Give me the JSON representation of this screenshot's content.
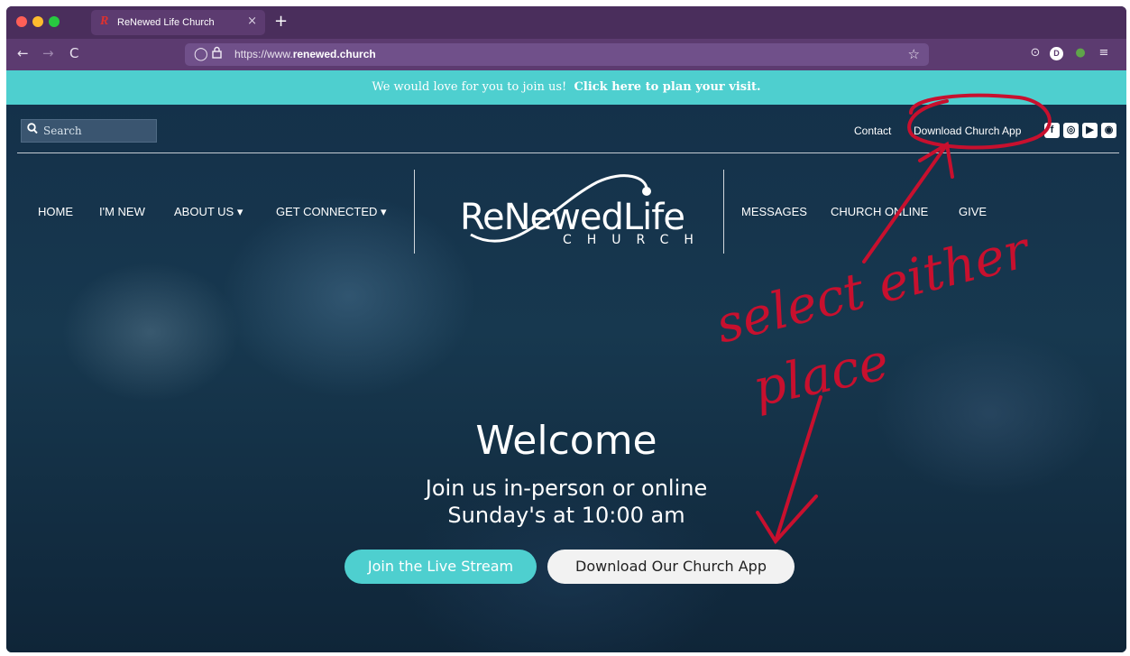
{
  "browser": {
    "tab_title": "ReNewed Life Church",
    "tab_favicon": "R",
    "tab_close": "×",
    "new_tab": "+",
    "url_prefix": "https://www.",
    "url_domain": "renewed.church",
    "avatar_letter": "D",
    "icons": {
      "back": "←",
      "forward": "→",
      "reload": "C",
      "shield": "◯",
      "lock": "🔒",
      "star": "☆",
      "pocket": "⊙",
      "extension": "●",
      "menu": "≡"
    }
  },
  "announcement": {
    "text": "We would love for you to join us!",
    "link": "Click here to plan your visit."
  },
  "utility": {
    "search_placeholder": "Search",
    "contact": "Contact",
    "download_app": "Download Church App",
    "social": [
      "f",
      "◎",
      "▶",
      "◉"
    ]
  },
  "nav_left": [
    "HOME",
    "I'M NEW",
    "ABOUT US ▾",
    "GET CONNECTED ▾"
  ],
  "nav_right": [
    "MESSAGES",
    "CHURCH ONLINE",
    "GIVE"
  ],
  "logo": {
    "main": "ReNewedLife",
    "sub": "CHURCH"
  },
  "hero": {
    "title": "Welcome",
    "line1": "Join us in-person or online",
    "line2": "Sunday's at 10:00 am",
    "btn_live": "Join the Live Stream",
    "btn_app": "Download Our Church App"
  },
  "annotation": {
    "line1": "select either",
    "line2": "place",
    "color": "#c8102e"
  },
  "colors": {
    "teal": "#4ecfcf",
    "chrome": "#5c3b70",
    "tabstrip": "#4a2e5c"
  }
}
